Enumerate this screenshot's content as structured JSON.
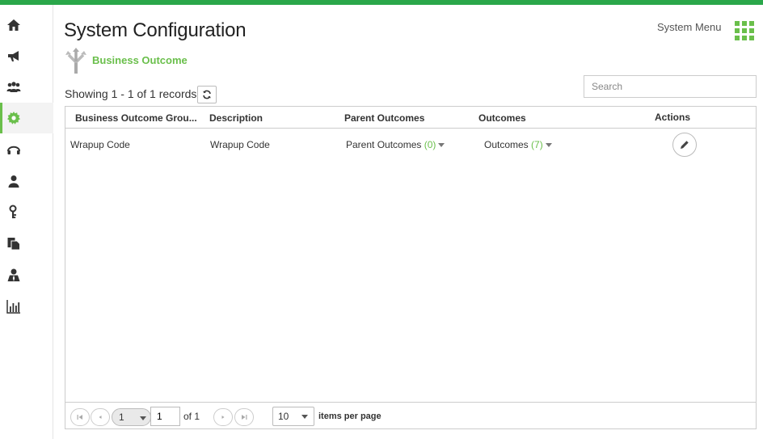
{
  "header": {
    "title": "System Configuration",
    "system_menu_label": "System Menu",
    "accent_color": "#6abf4b",
    "topbar_color": "#2aa74a"
  },
  "sidebar": {
    "items": [
      {
        "icon": "home-icon"
      },
      {
        "icon": "megaphone-icon"
      },
      {
        "icon": "users-icon"
      },
      {
        "icon": "gear-icon",
        "active": true
      },
      {
        "icon": "headset-icon"
      },
      {
        "icon": "user-icon"
      },
      {
        "icon": "key-icon"
      },
      {
        "icon": "documents-icon"
      },
      {
        "icon": "agent-icon"
      },
      {
        "icon": "bar-chart-icon"
      }
    ]
  },
  "section": {
    "label": "Business Outcome",
    "icon": "branch-icon"
  },
  "toolbar": {
    "showing_text": "Showing 1 - 1 of 1 records",
    "search_placeholder": "Search"
  },
  "table": {
    "columns": [
      "Business Outcome Grou...",
      "Description",
      "Parent Outcomes",
      "Outcomes",
      "Actions"
    ],
    "rows": [
      {
        "group": "Wrapup Code",
        "description": "Wrapup Code",
        "parent_label": "Parent Outcomes",
        "parent_count": "(0)",
        "outcomes_label": "Outcomes",
        "outcomes_count": "(7)"
      }
    ]
  },
  "pager": {
    "current_page": "1",
    "page_input_value": "1",
    "of_text": "of 1",
    "page_size": "10",
    "items_per_page_label": "items per page"
  }
}
